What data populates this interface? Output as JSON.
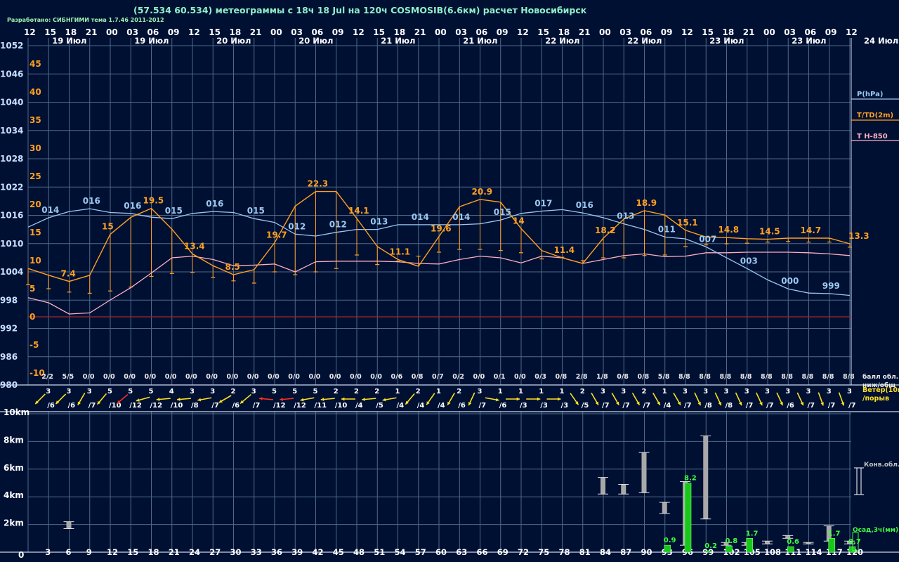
{
  "header": {
    "title": "(57.534 60.534) метеограммы с  18ч 18 Jul на 120ч COSMOSIB(6.6км) расчет Новосибирск",
    "credit": "Разработано: СИБНГИМИ тема 1.7.46 2011-2012"
  },
  "chart_data": {
    "type": "line",
    "hours_top": [
      "12",
      "15",
      "18",
      "21",
      "00",
      "03",
      "06",
      "09",
      "12",
      "15",
      "18",
      "21",
      "00",
      "03",
      "06",
      "09",
      "12",
      "15",
      "18",
      "21",
      "00",
      "03",
      "06",
      "09",
      "12",
      "15",
      "18",
      "21",
      "00",
      "03",
      "06",
      "09",
      "12",
      "15",
      "18",
      "21",
      "00",
      "03",
      "06",
      "09",
      "12"
    ],
    "date_labels": [
      "19 Июл",
      "19 Июл",
      "20 Июл",
      "20 Июл",
      "21 Июл",
      "21 Июл",
      "22 Июл",
      "22 Июл",
      "23 Июл",
      "23 Июл",
      "24 Июл"
    ],
    "forecast_hours": [
      "0",
      "3",
      "6",
      "9",
      "12",
      "15",
      "18",
      "21",
      "24",
      "27",
      "30",
      "33",
      "36",
      "39",
      "42",
      "45",
      "48",
      "51",
      "54",
      "57",
      "60",
      "63",
      "66",
      "69",
      "72",
      "75",
      "78",
      "81",
      "84",
      "87",
      "90",
      "93",
      "96",
      "99",
      "102",
      "105",
      "108",
      "111",
      "114",
      "117",
      "120"
    ],
    "pressure_axis": {
      "ticks": [
        "1052",
        "1046",
        "1040",
        "1034",
        "1028",
        "1022",
        "1016",
        "1010",
        "1004",
        "998",
        "992",
        "986",
        "980"
      ],
      "range": [
        980,
        1052
      ]
    },
    "temperature_axis": {
      "ticks": [
        "45",
        "40",
        "35",
        "30",
        "25",
        "20",
        "15",
        "10",
        "5",
        "0",
        "-5",
        "-10"
      ],
      "range": [
        -13,
        47
      ]
    },
    "legend": {
      "pressure": "P(hPa)",
      "temperature": "T/TD(2m)",
      "t850": "T H-850",
      "pressure_color": "#9bc8f0",
      "temperature_color": "#ffa020",
      "t850_color": "#ffb0c0"
    },
    "series": [
      {
        "name": "P(hPa)",
        "values": [
          1013.5,
          1015.5,
          1016.8,
          1017.4,
          1016.6,
          1016.4,
          1015.6,
          1015.3,
          1016.4,
          1016.8,
          1016.6,
          1015.3,
          1014.5,
          1012.0,
          1011.6,
          1012.4,
          1013.0,
          1013.0,
          1014.0,
          1014.0,
          1014.0,
          1014.0,
          1014.2,
          1015.0,
          1016.4,
          1016.9,
          1017.2,
          1016.5,
          1015.5,
          1014.2,
          1013.0,
          1011.4,
          1011.0,
          1009.3,
          1007.0,
          1004.7,
          1002.3,
          1000.4,
          999.5,
          999.4,
          999.0
        ]
      },
      {
        "name": "T/TD(2m)",
        "values": [
          8.6,
          7.4,
          6.3,
          7.4,
          14.7,
          17.7,
          19.3,
          15.6,
          11.2,
          9.1,
          7.5,
          8.4,
          13.2,
          19.7,
          22.3,
          22.3,
          17.5,
          12.5,
          10.2,
          9.0,
          14.3,
          19.6,
          20.9,
          20.4,
          15.7,
          11.8,
          10.5,
          9.5,
          14.0,
          17.4,
          18.9,
          18.1,
          15.4,
          14.2,
          14.1,
          13.9,
          13.8,
          14.0,
          14.0,
          14.0,
          13.0
        ]
      },
      {
        "name": "TD(2m)",
        "values": [
          5.7,
          5.0,
          4.4,
          4.2,
          4.6,
          5.3,
          7.2,
          7.7,
          7.9,
          7.0,
          6.4,
          6.0,
          8.0,
          7.5,
          8.0,
          8.6,
          11.0,
          9.3,
          9.9,
          10.8,
          11.5,
          12.0,
          12.0,
          11.8,
          11.4,
          10.3,
          10.6,
          10.0,
          10.5,
          10.5,
          10.9,
          11.0,
          12.5,
          12.8,
          13.0,
          13.1,
          13.3,
          13.4,
          13.3,
          13.3,
          12.4
        ]
      },
      {
        "name": "T H-850",
        "values": [
          3.4,
          2.5,
          0.5,
          0.7,
          3.0,
          5.2,
          7.8,
          10.5,
          10.8,
          10.2,
          9.1,
          9.2,
          9.4,
          8.0,
          9.8,
          9.9,
          9.9,
          9.9,
          9.8,
          9.5,
          9.4,
          10.2,
          10.8,
          10.5,
          9.6,
          10.8,
          10.5,
          9.5,
          10.2,
          10.9,
          11.2,
          10.7,
          10.8,
          11.4,
          11.4,
          11.5,
          11.5,
          11.5,
          11.4,
          11.2,
          10.9
        ]
      }
    ],
    "data_labels": {
      "pressure": [
        {
          "i": 1,
          "text": "014"
        },
        {
          "i": 3,
          "text": "016"
        },
        {
          "i": 5,
          "text": "016"
        },
        {
          "i": 7,
          "text": "015"
        },
        {
          "i": 9,
          "text": "016"
        },
        {
          "i": 11,
          "text": "015"
        },
        {
          "i": 13,
          "text": "012"
        },
        {
          "i": 15,
          "text": "012"
        },
        {
          "i": 17,
          "text": "013"
        },
        {
          "i": 19,
          "text": "014"
        },
        {
          "i": 21,
          "text": "014"
        },
        {
          "i": 23,
          "text": "015"
        },
        {
          "i": 25,
          "text": "017"
        },
        {
          "i": 27,
          "text": "016"
        },
        {
          "i": 29,
          "text": "013"
        },
        {
          "i": 31,
          "text": "011"
        },
        {
          "i": 33,
          "text": "007"
        },
        {
          "i": 35,
          "text": "003"
        },
        {
          "i": 37,
          "text": "000"
        },
        {
          "i": 39,
          "text": "999"
        }
      ],
      "temperature": [
        {
          "i": 2,
          "text": "7.4"
        },
        {
          "i": 4,
          "text": "15"
        },
        {
          "i": 6,
          "text": "19.5"
        },
        {
          "i": 8,
          "text": "13.4"
        },
        {
          "i": 10,
          "text": "8.5"
        },
        {
          "i": 12,
          "text": "19.7"
        },
        {
          "i": 14,
          "text": "22.3"
        },
        {
          "i": 16,
          "text": "14.1"
        },
        {
          "i": 18,
          "text": "11.1"
        },
        {
          "i": 20,
          "text": "19.6"
        },
        {
          "i": 22,
          "text": "20.9"
        },
        {
          "i": 24,
          "text": "14"
        },
        {
          "i": 26,
          "text": "11.4"
        },
        {
          "i": 28,
          "text": "18.2"
        },
        {
          "i": 30,
          "text": "18.9"
        },
        {
          "i": 32,
          "text": "15.1"
        },
        {
          "i": 34,
          "text": "14.8"
        },
        {
          "i": 36,
          "text": "14.5"
        },
        {
          "i": 38,
          "text": "14.7"
        },
        {
          "i": 40,
          "text": "13.3"
        }
      ]
    },
    "cloud_cover": [
      "2/2",
      "5/5",
      "0/0",
      "0/0",
      "0/0",
      "0/0",
      "0/0",
      "0/0",
      "0/0",
      "0/0",
      "0/0",
      "0/0",
      "0/0",
      "0/0",
      "0/0",
      "0/0",
      "0/0",
      "0/6",
      "0/8",
      "0/7",
      "0/2",
      "0/0",
      "0/1",
      "0/0",
      "0/3",
      "0/8",
      "2/8",
      "1/8",
      "0/8",
      "0/8",
      "5/8",
      "8/8",
      "8/8",
      "8/8",
      "8/8",
      "8/8",
      "8/8",
      "8/8",
      "8/8",
      "8/8"
    ],
    "cloud_cover_label": [
      "балл обл.",
      "ниж/общ"
    ],
    "wind": {
      "label": [
        "Ветер(10м)",
        "/порыв"
      ],
      "speed": [
        "3",
        "3",
        "3",
        "5",
        "5",
        "5",
        "4",
        "3",
        "3",
        "2",
        "3",
        "5",
        "5",
        "5",
        "2",
        "2",
        "2",
        "1",
        "2",
        "1",
        "2",
        "3",
        "1",
        "1",
        "1",
        "1",
        "2",
        "3",
        "3",
        "2",
        "1",
        "3",
        "3",
        "3",
        "3",
        "3",
        "3",
        "3",
        "3",
        "3"
      ],
      "gust": [
        "/6",
        "/6",
        "/7",
        "/10",
        "/12",
        "/12",
        "/10",
        "/8",
        "/7",
        "/6",
        "/7",
        "/12",
        "/12",
        "/11",
        "/10",
        "/4",
        "/5",
        "/4",
        "/4",
        "/4",
        "/6",
        "/7",
        "/6",
        "/3",
        "/3",
        "/3",
        "/5",
        "/7",
        "/7",
        "/7",
        "/4",
        "/7",
        "/8",
        "/8",
        "/7",
        "/7",
        "/6",
        "/7",
        "/7",
        "/7"
      ],
      "dir_deg": [
        -135,
        -135,
        -120,
        -130,
        -140,
        -165,
        -175,
        -175,
        -170,
        -150,
        -140,
        -185,
        -175,
        -170,
        -175,
        -180,
        -175,
        -170,
        -130,
        -125,
        -120,
        -115,
        -10,
        0,
        0,
        0,
        -55,
        -60,
        -60,
        -60,
        -60,
        -60,
        -65,
        -65,
        -65,
        -65,
        -65,
        -65,
        -70,
        -70
      ],
      "strong_color": "#ff3020",
      "strong_indices": [
        4,
        11,
        12
      ]
    },
    "height_axis": {
      "ticks": [
        "10km",
        "8km",
        "6km",
        "4km",
        "2km",
        "0"
      ],
      "range_km": [
        0,
        10.4
      ]
    },
    "convective_clouds": {
      "label": "Конв.обл.",
      "bars": [
        {
          "i": 2,
          "bottom": 1.7,
          "top": 2.2
        },
        {
          "i": 28,
          "bottom": 4.2,
          "top": 5.4
        },
        {
          "i": 29,
          "bottom": 4.2,
          "top": 4.9
        },
        {
          "i": 30,
          "bottom": 4.3,
          "top": 7.2
        },
        {
          "i": 31,
          "bottom": 2.8,
          "top": 3.6
        },
        {
          "i": 32,
          "bottom": 0.5,
          "top": 5.1
        },
        {
          "i": 33,
          "bottom": 2.4,
          "top": 8.4
        },
        {
          "i": 34,
          "bottom": 0.5,
          "top": 0.7
        },
        {
          "i": 35,
          "bottom": 0.5,
          "top": 0.7
        },
        {
          "i": 36,
          "bottom": 0.6,
          "top": 0.8
        },
        {
          "i": 37,
          "bottom": 1.0,
          "top": 1.2
        },
        {
          "i": 38,
          "bottom": 0.6,
          "top": 0.7
        },
        {
          "i": 39,
          "bottom": 0.8,
          "top": 1.9
        },
        {
          "i": 40,
          "bottom": 0.6,
          "top": 0.8
        }
      ]
    },
    "precipitation": {
      "label": "Осад,3ч(мм)",
      "bars": [
        {
          "i": 31,
          "value": "0.9",
          "h": 0.5
        },
        {
          "i": 32,
          "value": "8.2",
          "h": 5.0
        },
        {
          "i": 33,
          "value": "0.2",
          "h": 0.1
        },
        {
          "i": 34,
          "value": "0.8",
          "h": 0.45
        },
        {
          "i": 35,
          "value": "1.7",
          "h": 1.0
        },
        {
          "i": 37,
          "value": "0.6",
          "h": 0.4
        },
        {
          "i": 39,
          "value": "1.7",
          "h": 1.0
        },
        {
          "i": 40,
          "value": "0.7",
          "h": 0.4
        }
      ]
    },
    "grid": true
  }
}
